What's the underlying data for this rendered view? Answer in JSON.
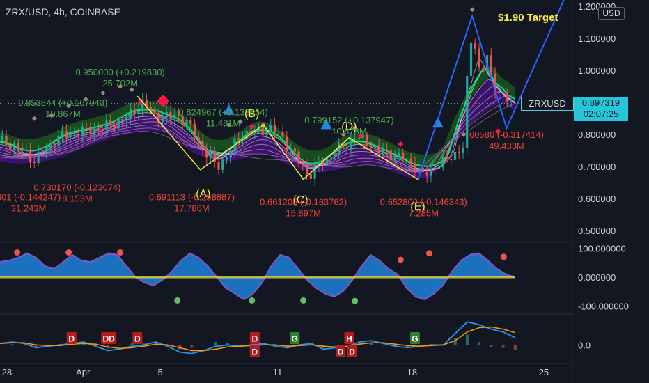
{
  "header": {
    "title": "ZRX/USD, 4h, COINBASE"
  },
  "currency_badge": "USD",
  "price_tag": {
    "symbol": "ZRXUSD",
    "price": "0.897319",
    "countdown": "02:07:25"
  },
  "colors": {
    "background": "#131722",
    "up": "#26a69a",
    "down": "#ef5350",
    "annotation_up": "#4caf50",
    "annotation_down": "#f44336",
    "pattern_line": "#ffeb3b",
    "target_line": "#2962ff",
    "ema_green": "#00e676",
    "cloud_green": "#1b5e20",
    "cloud_purple": "#4a148c",
    "osc_fill": "#1e88e5",
    "macd_line": "#2196f3",
    "signal_line": "#ff9800"
  },
  "chart_data": [
    {
      "type": "line",
      "panel": "price",
      "series_main": [
        {
          "t": 0,
          "v": 0.78
        },
        {
          "t": 3,
          "v": 0.76
        },
        {
          "t": 6,
          "v": 0.72
        },
        {
          "t": 10,
          "v": 0.79
        },
        {
          "t": 14,
          "v": 0.81
        },
        {
          "t": 18,
          "v": 0.82
        },
        {
          "t": 22,
          "v": 0.85
        },
        {
          "t": 25,
          "v": 0.9
        },
        {
          "t": 27,
          "v": 0.86
        },
        {
          "t": 29,
          "v": 0.855
        },
        {
          "t": 31,
          "v": 0.86
        },
        {
          "t": 33,
          "v": 0.83
        },
        {
          "t": 36,
          "v": 0.74
        },
        {
          "t": 38,
          "v": 0.7
        },
        {
          "t": 40,
          "v": 0.74
        },
        {
          "t": 42,
          "v": 0.8
        },
        {
          "t": 45,
          "v": 0.81
        },
        {
          "t": 47,
          "v": 0.82
        },
        {
          "t": 49,
          "v": 0.8
        },
        {
          "t": 52,
          "v": 0.72
        },
        {
          "t": 54,
          "v": 0.67
        },
        {
          "t": 56,
          "v": 0.71
        },
        {
          "t": 58,
          "v": 0.74
        },
        {
          "t": 60,
          "v": 0.76
        },
        {
          "t": 62,
          "v": 0.79
        },
        {
          "t": 64,
          "v": 0.78
        },
        {
          "t": 66,
          "v": 0.75
        },
        {
          "t": 68,
          "v": 0.74
        },
        {
          "t": 70,
          "v": 0.73
        },
        {
          "t": 72,
          "v": 0.71
        },
        {
          "t": 74,
          "v": 0.67
        },
        {
          "t": 76,
          "v": 0.7
        },
        {
          "t": 78,
          "v": 0.72
        },
        {
          "t": 80,
          "v": 0.75
        },
        {
          "t": 81,
          "v": 0.76
        },
        {
          "t": 82,
          "v": 1.1
        },
        {
          "t": 83,
          "v": 1.08
        },
        {
          "t": 84,
          "v": 0.97
        },
        {
          "t": 85,
          "v": 1.05
        },
        {
          "t": 86,
          "v": 0.96
        },
        {
          "t": 87,
          "v": 0.94
        },
        {
          "t": 88,
          "v": 0.92
        },
        {
          "t": 89,
          "v": 0.9
        },
        {
          "t": 90,
          "v": 0.897
        }
      ],
      "t_max": 100,
      "pattern_line": [
        {
          "t": 24,
          "v": 0.92
        },
        {
          "t": 35,
          "v": 0.69
        },
        {
          "t": 46,
          "v": 0.83
        },
        {
          "t": 53,
          "v": 0.66
        },
        {
          "t": 61,
          "v": 0.79
        },
        {
          "t": 73,
          "v": 0.66
        },
        {
          "t": 82.5,
          "v": 1.17
        }
      ],
      "target_line": [
        {
          "t": 73,
          "v": 0.66
        },
        {
          "t": 82.5,
          "v": 1.17
        },
        {
          "t": 88.5,
          "v": 0.82
        },
        {
          "t": 100,
          "v": 1.28
        }
      ],
      "pattern_labels": [
        {
          "text": "(A)",
          "t": 35.5,
          "v": 0.605
        },
        {
          "text": "(B)",
          "t": 44,
          "v": 0.855
        },
        {
          "text": "(C)",
          "t": 52.5,
          "v": 0.585
        },
        {
          "text": "(D)",
          "t": 61,
          "v": 0.815
        },
        {
          "text": "(E)",
          "t": 73,
          "v": 0.565
        }
      ],
      "target_label": "$1.90 Target",
      "annotations_up": [
        {
          "line1": "0.950000 (+0.219830)",
          "line2": "25.702M",
          "t": 21,
          "v": 0.985
        },
        {
          "line1": "0.853844 (+0.167043)",
          "line2": "19.867M",
          "t": 11,
          "v": 0.89
        },
        {
          "line1": "0.824967 (+0.133854)",
          "line2": "11.481M",
          "t": 39,
          "v": 0.86
        },
        {
          "line1": "0.799152 (+0.137947)",
          "line2": "10.678M",
          "t": 61,
          "v": 0.835
        }
      ],
      "annotations_down": [
        {
          "line1": "0.730170 (-0.123674)",
          "line2": "8.153M",
          "t": 13.5,
          "v": 0.625
        },
        {
          "line1": "801 (-0.144247)",
          "line2": "31.243M",
          "t": 5,
          "v": 0.595
        },
        {
          "line1": "0.691113 (-0.258887)",
          "line2": "17.786M",
          "t": 33.5,
          "v": 0.595
        },
        {
          "line1": "0.661205 (-0.163762)",
          "line2": "15.897M",
          "t": 53,
          "v": 0.58
        },
        {
          "line1": "0.652809 (-0.146343)",
          "line2": "7.285M",
          "t": 74,
          "v": 0.58
        },
        {
          "line1": "60586 (-0.317414)",
          "line2": "49.433M",
          "t": 88.5,
          "v": 0.79
        }
      ],
      "y_ticks": [
        "1.200000",
        "1.100000",
        "1.000000",
        "0.900000",
        "0.800000",
        "0.700000",
        "0.600000",
        "0.500000"
      ],
      "y_tick_values": [
        1.2,
        1.1,
        1.0,
        0.9,
        0.8,
        0.7,
        0.6,
        0.5
      ],
      "ylim": [
        0.47,
        1.22
      ]
    },
    {
      "type": "area",
      "panel": "oscillator",
      "values": [
        55,
        60,
        70,
        85,
        70,
        40,
        30,
        55,
        80,
        60,
        55,
        70,
        85,
        80,
        40,
        0,
        -20,
        -30,
        -10,
        20,
        60,
        85,
        70,
        40,
        0,
        -40,
        -60,
        -80,
        -60,
        -20,
        40,
        80,
        70,
        30,
        -10,
        -40,
        -60,
        -70,
        -50,
        -10,
        40,
        80,
        60,
        30,
        10,
        -40,
        -70,
        -80,
        -60,
        -30,
        20,
        60,
        80,
        85,
        60,
        30,
        10,
        0
      ],
      "y_ticks": [
        "100.000000",
        "0.000000",
        "-100.000000"
      ],
      "y_tick_values": [
        100,
        0,
        -100
      ],
      "ylim": [
        -115,
        115
      ]
    },
    {
      "type": "line",
      "panel": "macd",
      "macd": [
        0.1,
        0.2,
        0.1,
        -0.2,
        -0.1,
        0.0,
        0.1,
        0.2,
        -0.1,
        -0.4,
        -0.3,
        -0.1,
        0.0,
        0.2,
        -0.1,
        -0.5,
        -0.6,
        -0.4,
        -0.1,
        0.0,
        -0.1,
        0.0,
        0.1,
        -0.1,
        -0.2,
        0.0,
        0.1,
        -0.3,
        -0.2,
        -0.1,
        0.2,
        0.3,
        0.1,
        -0.1,
        -0.2,
        -0.1,
        0.0,
        0.0,
        0.8,
        1.6,
        1.4,
        1.1,
        0.9,
        0.5
      ],
      "signal": [
        0.1,
        0.15,
        0.15,
        0.0,
        -0.05,
        -0.05,
        0.05,
        0.1,
        0.05,
        -0.15,
        -0.25,
        -0.2,
        -0.1,
        0.05,
        0.0,
        -0.2,
        -0.4,
        -0.4,
        -0.3,
        -0.15,
        -0.1,
        -0.05,
        0.0,
        0.0,
        -0.1,
        -0.05,
        0.0,
        -0.1,
        -0.15,
        -0.1,
        0.05,
        0.15,
        0.15,
        0.05,
        -0.05,
        -0.1,
        -0.05,
        0.0,
        0.3,
        0.9,
        1.2,
        1.25,
        1.1,
        0.85
      ],
      "signals": [
        {
          "text": "D",
          "t": 12.5,
          "color": "#b71c1c"
        },
        {
          "text": "DD",
          "t": 19,
          "color": "#b71c1c"
        },
        {
          "text": "D",
          "t": 24,
          "color": "#b71c1c"
        },
        {
          "text": "D",
          "t": 44.5,
          "color": "#b71c1c"
        },
        {
          "text": "D",
          "t": 44.5,
          "color": "#b71c1c",
          "row": 2
        },
        {
          "text": "G",
          "t": 51.5,
          "color": "#2e7d32"
        },
        {
          "text": "H",
          "t": 61,
          "color": "#b71c1c"
        },
        {
          "text": "D",
          "t": 59.5,
          "color": "#b71c1c",
          "row": 2
        },
        {
          "text": "D",
          "t": 61.5,
          "color": "#b71c1c",
          "row": 2
        },
        {
          "text": "G",
          "t": 72.5,
          "color": "#2e7d32"
        }
      ],
      "y_ticks": [
        "0.0"
      ],
      "y_tick_values": [
        0
      ],
      "ylim": [
        -1.2,
        2.0
      ]
    }
  ],
  "x_axis": {
    "labels": [
      "28",
      "Apr",
      "5",
      "11",
      "18",
      "25"
    ],
    "label_t": [
      1.2,
      14.5,
      28,
      48.5,
      72,
      95
    ]
  }
}
